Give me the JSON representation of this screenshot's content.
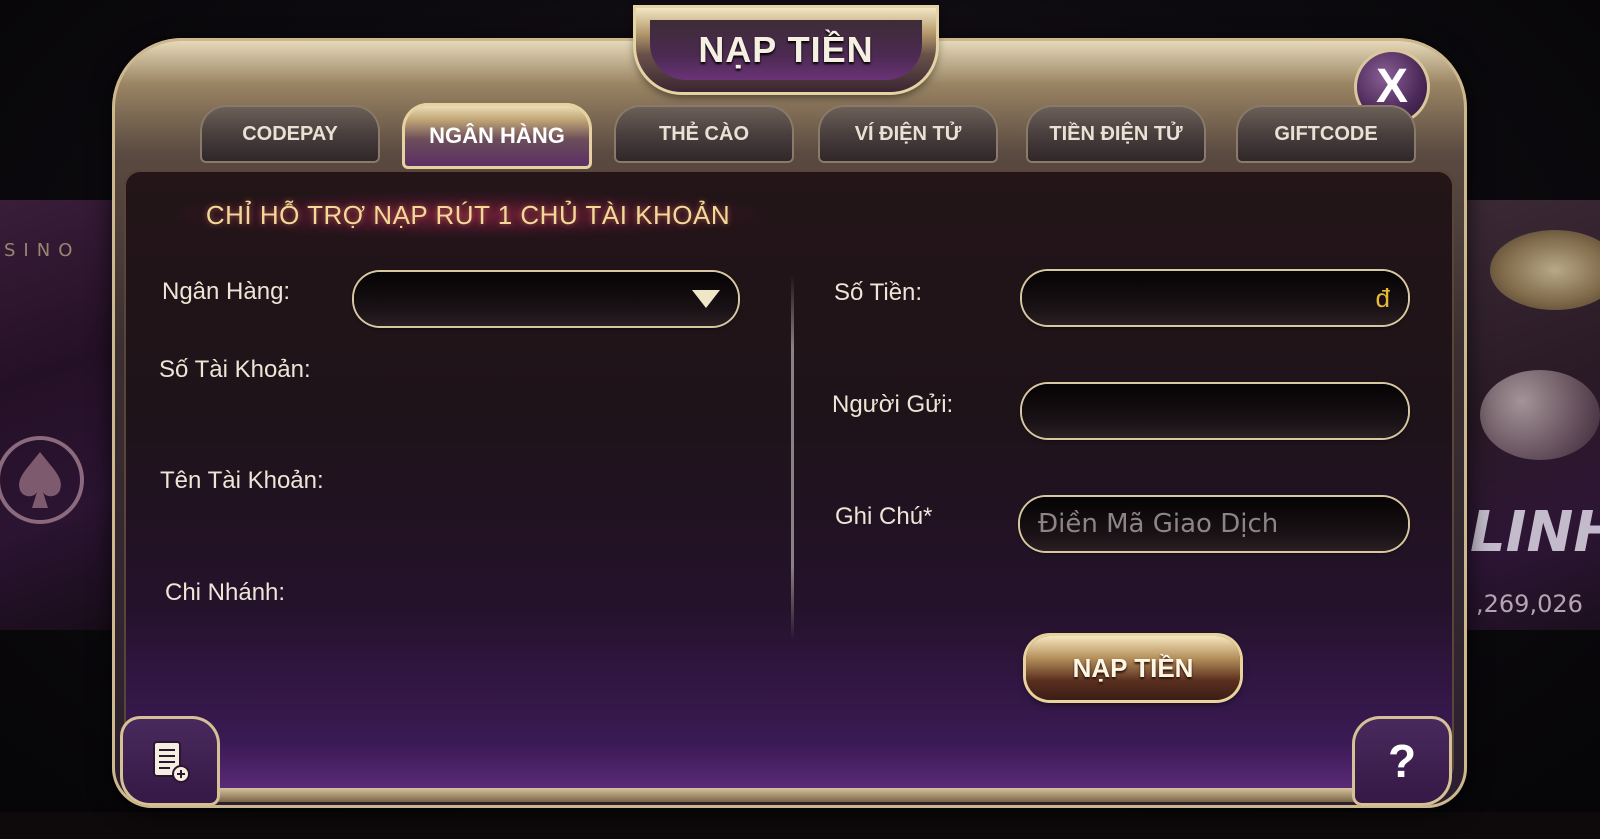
{
  "dialog": {
    "title": "NẠP TIỀN",
    "close_label": "X"
  },
  "tabs": [
    {
      "label": "CODEPAY",
      "active": false
    },
    {
      "label": "NGÂN HÀNG",
      "active": true
    },
    {
      "label": "THẺ CÀO",
      "active": false
    },
    {
      "label": "VÍ ĐIỆN TỬ",
      "active": false
    },
    {
      "label": "TIỀN ĐIỆN TỬ",
      "active": false
    },
    {
      "label": "GIFTCODE",
      "active": false
    }
  ],
  "notice": "CHỈ HỖ TRỢ NẠP RÚT 1 CHỦ TÀI KHOẢN",
  "left_form": {
    "bank_label": "Ngân Hàng:",
    "bank_value": "",
    "account_number_label": "Số Tài Khoản:",
    "account_name_label": "Tên Tài Khoản:",
    "branch_label": "Chi Nhánh:"
  },
  "right_form": {
    "amount_label": "Số Tiền:",
    "amount_value": "",
    "amount_unit": "đ",
    "sender_label": "Người Gửi:",
    "sender_value": "",
    "note_label": "Ghi Chú*",
    "note_placeholder": "Điền Mã Giao Dịch"
  },
  "submit_label": "NẠP TIỀN",
  "help_label": "?",
  "background": {
    "left_tile_text": "SINO",
    "right_tile_text": "LINH",
    "right_tile_stat": ",269,026"
  },
  "colors": {
    "accent_gold": "#d8c8a2",
    "notice_text": "#f1d99a",
    "currency_gold": "#e9b937",
    "panel_purple": "#5d2c7c"
  }
}
